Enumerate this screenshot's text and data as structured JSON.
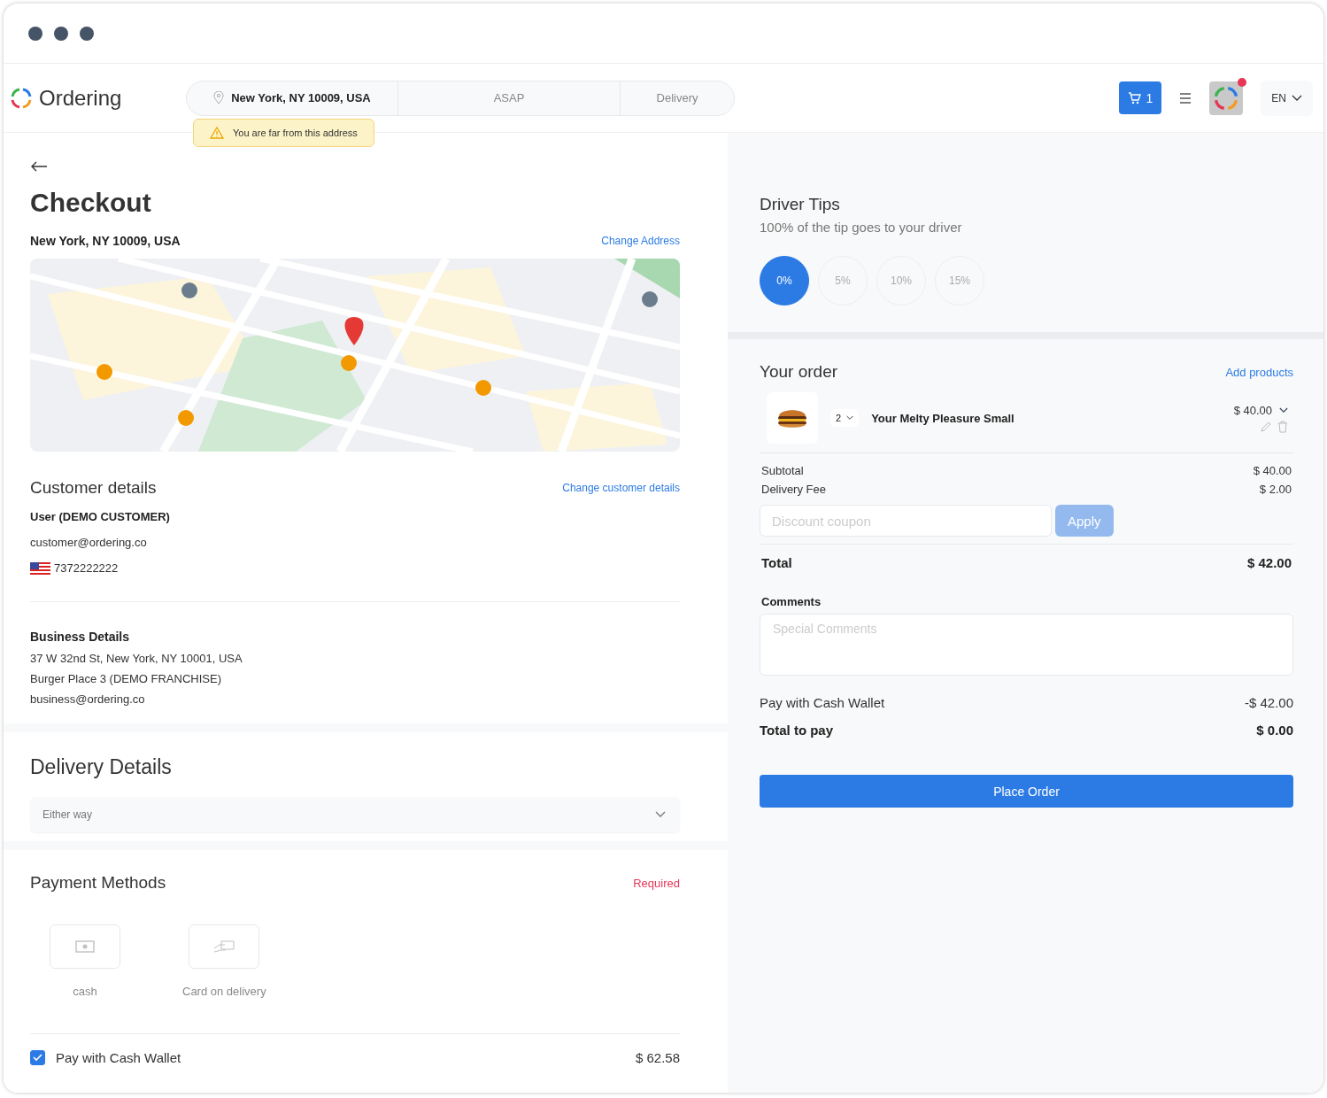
{
  "header": {
    "brand": "Ordering",
    "address": "New York, NY 10009, USA",
    "time": "ASAP",
    "mode": "Delivery",
    "warning": "You are far from this address",
    "cart_count": "1",
    "notification": true,
    "language": "EN"
  },
  "checkout": {
    "title": "Checkout",
    "address": "New York, NY 10009, USA",
    "change_address": "Change Address"
  },
  "customer": {
    "title": "Customer details",
    "change": "Change customer details",
    "name": "User (DEMO CUSTOMER)",
    "email": "customer@ordering.co",
    "phone": "7372222222"
  },
  "business": {
    "title": "Business Details",
    "lines": [
      "37 W 32nd St, New York, NY 10001, USA",
      "Burger Place 3 (DEMO FRANCHISE)",
      "business@ordering.co"
    ]
  },
  "delivery": {
    "title": "Delivery Details",
    "option": "Either way"
  },
  "payment": {
    "title": "Payment Methods",
    "required": "Required",
    "methods": [
      {
        "label": "cash",
        "kind": "cash",
        "disabled": true
      },
      {
        "label": "Card on delivery",
        "kind": "card",
        "disabled": true
      }
    ],
    "wallet": {
      "label": "Pay with Cash Wallet",
      "checked": true,
      "amount": "$ 62.58"
    }
  },
  "tips": {
    "title": "Driver Tips",
    "subtitle": "100% of the tip goes to your driver",
    "options": [
      {
        "label": "0%",
        "selected": true
      },
      {
        "label": "5%",
        "selected": false
      },
      {
        "label": "10%",
        "selected": false
      },
      {
        "label": "15%",
        "selected": false
      }
    ]
  },
  "order": {
    "title": "Your order",
    "add": "Add products",
    "items": [
      {
        "quantity": "2",
        "name": "Your Melty Pleasure Small",
        "price": "$ 40.00"
      }
    ],
    "subtotal_label": "Subtotal",
    "subtotal": "$ 40.00",
    "fee_label": "Delivery Fee",
    "fee": "$ 2.00",
    "coupon_placeholder": "Discount coupon",
    "apply": "Apply",
    "apply_disabled": true,
    "total_label": "Total",
    "total": "$ 42.00",
    "comments_label": "Comments",
    "comments_placeholder": "Special Comments",
    "wallet_label": "Pay with Cash Wallet",
    "wallet_amount": "-$ 42.00",
    "pay_label": "Total to pay",
    "pay_amount": "$ 0.00",
    "place_order": "Place Order"
  }
}
